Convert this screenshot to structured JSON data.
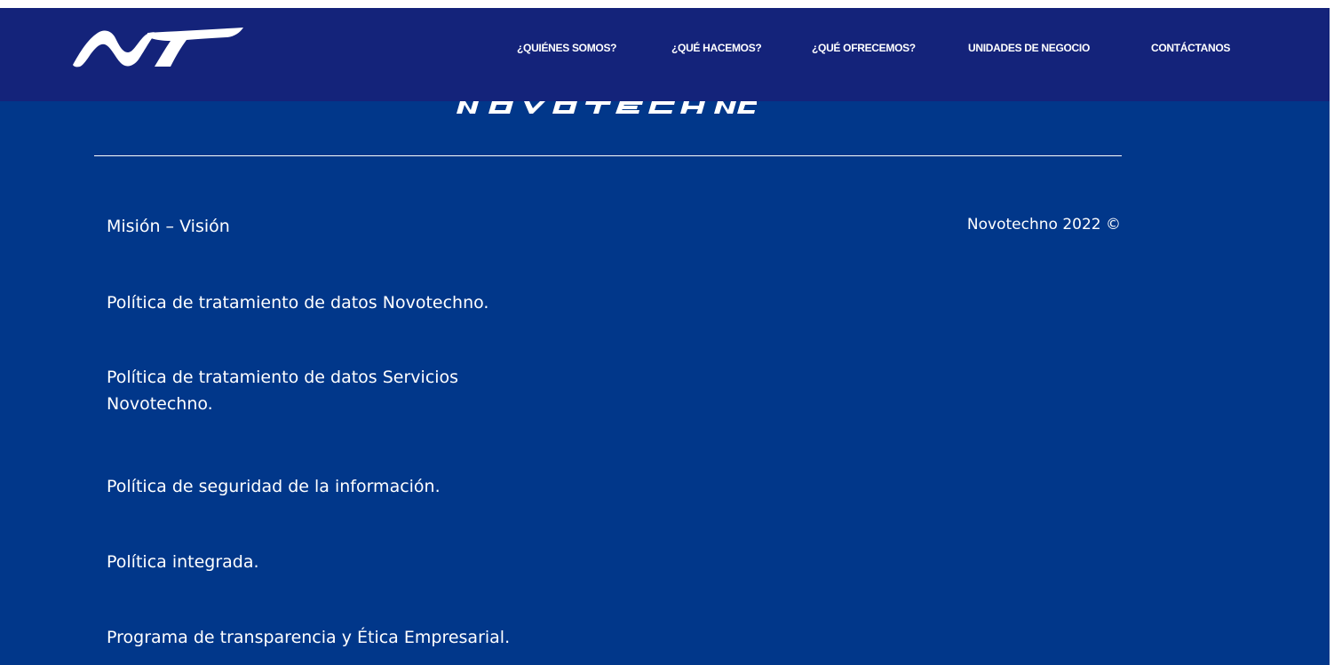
{
  "header": {
    "logo_icon": "novotechno-nt-logo",
    "nav": [
      {
        "label": "¿QUIÉNES SOMOS?"
      },
      {
        "label": "¿QUÉ HACEMOS?"
      },
      {
        "label": "¿QUÉ OFRECEMOS?"
      },
      {
        "label": "UNIDADES DE NEGOCIO"
      },
      {
        "label": "CONTÁCTANOS"
      }
    ]
  },
  "footer": {
    "brand_wordmark": "NOVOTECHNO",
    "links": [
      {
        "label": "Misión – Visión"
      },
      {
        "label": "Política de tratamiento de datos Novotechno."
      },
      {
        "label": "Política de tratamiento de datos Servicios Novotechno."
      },
      {
        "label": "Política de seguridad de la información."
      },
      {
        "label": "Política integrada."
      },
      {
        "label": "Programa de transparencia y Ética Empresarial."
      }
    ],
    "copyright": "Novotechno 2022 ©"
  },
  "colors": {
    "navbar_bg": "#14237a",
    "footer_bg": "#01378a",
    "text": "#ffffff"
  }
}
